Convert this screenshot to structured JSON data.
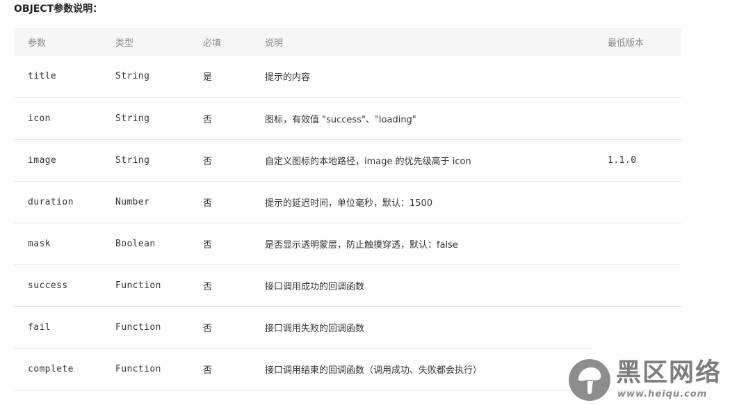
{
  "heading": "OBJECT参数说明：",
  "table": {
    "headers": {
      "name": "参数",
      "type": "类型",
      "required": "必填",
      "description": "说明",
      "min_version": "最低版本"
    },
    "rows": [
      {
        "name": "title",
        "type": "String",
        "required": "是",
        "description": "提示的内容",
        "min_version": ""
      },
      {
        "name": "icon",
        "type": "String",
        "required": "否",
        "description": "图标，有效值 \"success\"、\"loading\"",
        "min_version": ""
      },
      {
        "name": "image",
        "type": "String",
        "required": "否",
        "description": "自定义图标的本地路径，image 的优先级高于 icon",
        "min_version": "1.1.0"
      },
      {
        "name": "duration",
        "type": "Number",
        "required": "否",
        "description": "提示的延迟时间，单位毫秒，默认：1500",
        "min_version": ""
      },
      {
        "name": "mask",
        "type": "Boolean",
        "required": "否",
        "description": "是否显示透明蒙层，防止触摸穿透，默认：false",
        "min_version": ""
      },
      {
        "name": "success",
        "type": "Function",
        "required": "否",
        "description": "接口调用成功的回调函数",
        "min_version": ""
      },
      {
        "name": "fail",
        "type": "Function",
        "required": "否",
        "description": "接口调用失败的回调函数",
        "min_version": ""
      },
      {
        "name": "complete",
        "type": "Function",
        "required": "否",
        "description": "接口调用结束的回调函数（调用成功、失败都会执行）",
        "min_version": ""
      }
    ]
  },
  "watermark": {
    "brand": "黑区网络",
    "url": "www.heiqu.com"
  },
  "colors": {
    "link": "#4a78b5",
    "header_bg": "#f6f6f6",
    "divider": "#e6e6e6"
  }
}
